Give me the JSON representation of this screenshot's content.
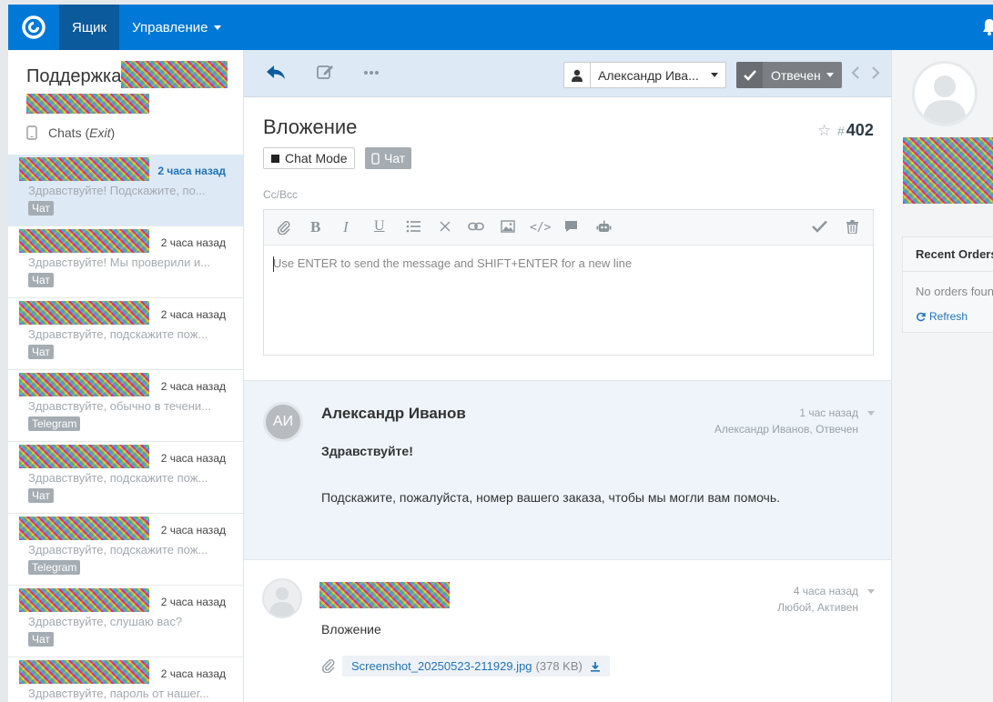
{
  "topnav": {
    "mailbox_label": "Ящик",
    "manage_label": "Управление"
  },
  "sidebar": {
    "mailbox_title": "Поддержка",
    "chats_label": "Chats",
    "chats_exit": "Exit",
    "conversations": [
      {
        "time": "2 часа назад",
        "preview": "Здравствуйте! Подскажите, по...",
        "channel": "Чат",
        "active": true
      },
      {
        "time": "2 часа назад",
        "preview": "Здравствуйте! Мы проверили и...",
        "channel": "Чат"
      },
      {
        "time": "2 часа назад",
        "preview": "Здравствуйте, подскажите пож...",
        "channel": "Чат"
      },
      {
        "time": "2 часа назад",
        "preview": "Здравствуйте, обычно в течени...",
        "channel": "Telegram"
      },
      {
        "time": "2 часа назад",
        "preview": "Здравствуйте, подскажите пож...",
        "channel": "Чат"
      },
      {
        "time": "2 часа назад",
        "preview": "Здравствуйте, подскажите пож...",
        "channel": "Telegram"
      },
      {
        "time": "2 часа назад",
        "preview": "Здравствуйте, слушаю вас?",
        "channel": "Чат"
      },
      {
        "time": "2 часа назад",
        "preview": "Здравствуйте, пароль от нашег...",
        "channel": ""
      }
    ]
  },
  "toolbar": {
    "assignee": "Александр Ива...",
    "status": "Отвечен"
  },
  "conversation": {
    "subject": "Вложение",
    "number": "402",
    "chat_mode_label": "Chat Mode",
    "channel_tag": "Чат",
    "cc_label": "Cc/Bcc",
    "editor_placeholder": "Use ENTER to send the message and SHIFT+ENTER for a new line"
  },
  "messages": [
    {
      "initials": "АИ",
      "author": "Александр Иванов",
      "time": "1 час назад",
      "status": "Александр Иванов, Отвечен",
      "greeting": "Здравствуйте!",
      "body": "Подскажите, пожалуйста, номер вашего заказа, чтобы мы могли вам помочь."
    },
    {
      "time": "4 часа назад",
      "status": "Любой, Активен",
      "body": "Вложение",
      "attachment_name": "Screenshot_20250523-211929.jpg",
      "attachment_size": "(378 KB)"
    }
  ],
  "right_panel": {
    "orders_title": "Recent Orders",
    "orders_empty": "No orders found",
    "refresh_label": "Refresh"
  },
  "colors": {
    "nav_blue": "#0078d7",
    "link_blue": "#2174b8",
    "active_row": "#dde9f5",
    "badge_gray": "#a5adb3"
  }
}
